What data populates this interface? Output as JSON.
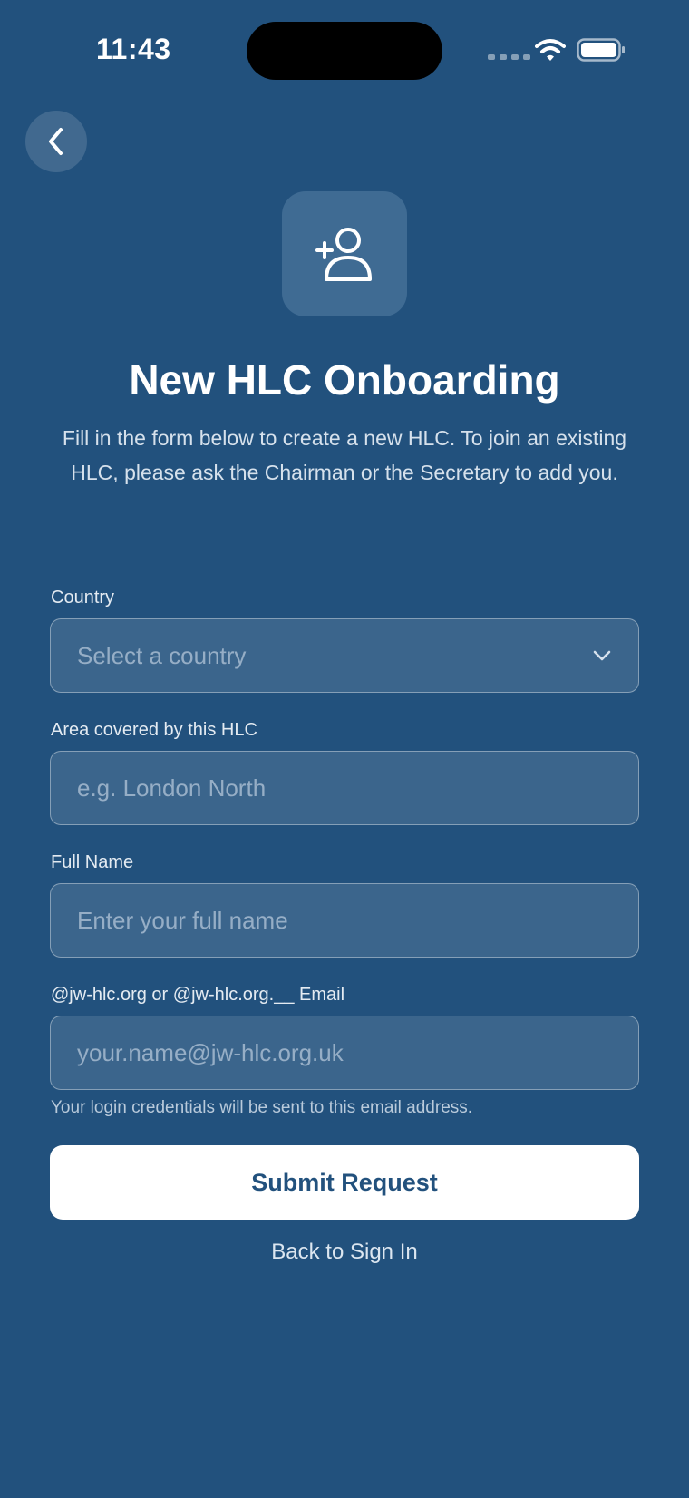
{
  "status_bar": {
    "time": "11:43",
    "wifi_icon": "wifi-icon",
    "battery_icon": "battery-icon"
  },
  "header": {
    "back_icon": "chevron-left-icon",
    "hero_icon": "add-user-icon"
  },
  "page": {
    "title": "New HLC Onboarding",
    "subtitle": "Fill in the form below to create a new HLC. To join an existing HLC, please ask the Chairman or the Secretary to add you."
  },
  "form": {
    "country": {
      "label": "Country",
      "placeholder": "Select a country",
      "icon": "chevron-down-icon"
    },
    "area": {
      "label": "Area covered by this HLC",
      "placeholder": "e.g. London North",
      "value": ""
    },
    "full_name": {
      "label": "Full Name",
      "placeholder": "Enter your full name",
      "value": ""
    },
    "email": {
      "label": "@jw-hlc.org or @jw-hlc.org.__ Email",
      "placeholder": "your.name@jw-hlc.org.uk",
      "value": "",
      "helper": "Your login credentials will be sent to this email address."
    },
    "submit_label": "Submit Request",
    "back_link": "Back to Sign In"
  },
  "colors": {
    "background": "#22517d",
    "field_bg": "#3b658c",
    "button_bg": "#ffffff",
    "button_text": "#22517d"
  }
}
